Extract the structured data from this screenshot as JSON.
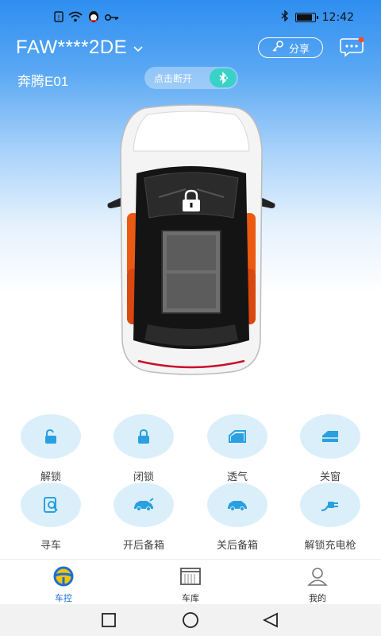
{
  "status_bar": {
    "time": "12:42",
    "battery_level": 0.85
  },
  "header": {
    "vehicle_id": "FAW****2DE",
    "share_label": "分享",
    "model_name": "奔腾E01",
    "bluetooth_label": "点击断开"
  },
  "controls": [
    {
      "label": "解锁",
      "icon": "unlock-icon"
    },
    {
      "label": "闭锁",
      "icon": "lock-icon"
    },
    {
      "label": "透气",
      "icon": "window-vent-icon"
    },
    {
      "label": "关窗",
      "icon": "window-close-icon"
    },
    {
      "label": "寻车",
      "icon": "find-car-icon"
    },
    {
      "label": "开后备箱",
      "icon": "trunk-open-icon"
    },
    {
      "label": "关后备箱",
      "icon": "trunk-close-icon"
    },
    {
      "label": "解锁充电枪",
      "icon": "charging-plug-icon"
    }
  ],
  "bottom_nav": [
    {
      "label": "车控",
      "icon": "steering-wheel-icon",
      "active": true
    },
    {
      "label": "车库",
      "icon": "garage-icon",
      "active": false
    },
    {
      "label": "我的",
      "icon": "profile-icon",
      "active": false
    }
  ],
  "colors": {
    "accent": "#1b6fd6",
    "control_bg": "#dbeffb",
    "control_icon": "#2aa0e0",
    "bluetooth": "#3ad1c6",
    "notification": "#f24d2a"
  }
}
